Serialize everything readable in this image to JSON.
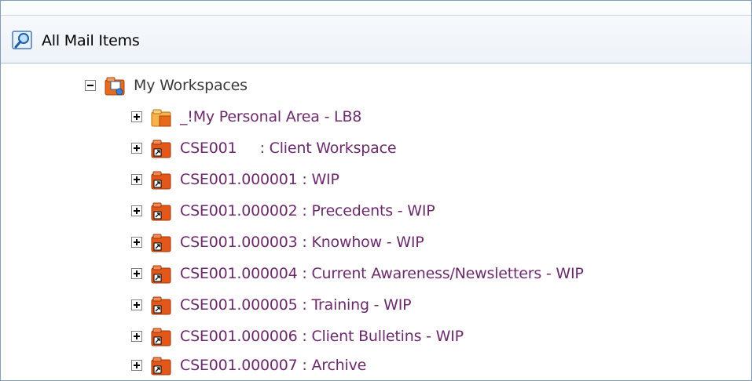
{
  "header": {
    "title": "All Mail Items",
    "icon": "search-folder-icon"
  },
  "tree": {
    "root": {
      "label": "My Workspaces",
      "expanded": true,
      "icon": "workspaces-folder-icon"
    },
    "items": [
      {
        "label": "_!My Personal Area - LB8",
        "icon": "personal-folder-icon"
      },
      {
        "label": "CSE001     : Client Workspace",
        "icon": "shortcut-folder-icon"
      },
      {
        "label": "CSE001.000001 : WIP",
        "icon": "shortcut-folder-icon"
      },
      {
        "label": "CSE001.000002 : Precedents - WIP",
        "icon": "shortcut-folder-icon"
      },
      {
        "label": "CSE001.000003 : Knowhow - WIP",
        "icon": "shortcut-folder-icon"
      },
      {
        "label": "CSE001.000004 : Current Awareness/Newsletters - WIP",
        "icon": "shortcut-folder-icon"
      },
      {
        "label": "CSE001.000005 : Training - WIP",
        "icon": "shortcut-folder-icon"
      },
      {
        "label": "CSE001.000006 : Client Bulletins - WIP",
        "icon": "shortcut-folder-icon"
      },
      {
        "label": "CSE001.000007 : Archive",
        "icon": "shortcut-folder-icon"
      }
    ]
  },
  "colors": {
    "item_text": "#6b2a6b",
    "root_text": "#3a3a3a",
    "header_border": "#aebfd6"
  }
}
